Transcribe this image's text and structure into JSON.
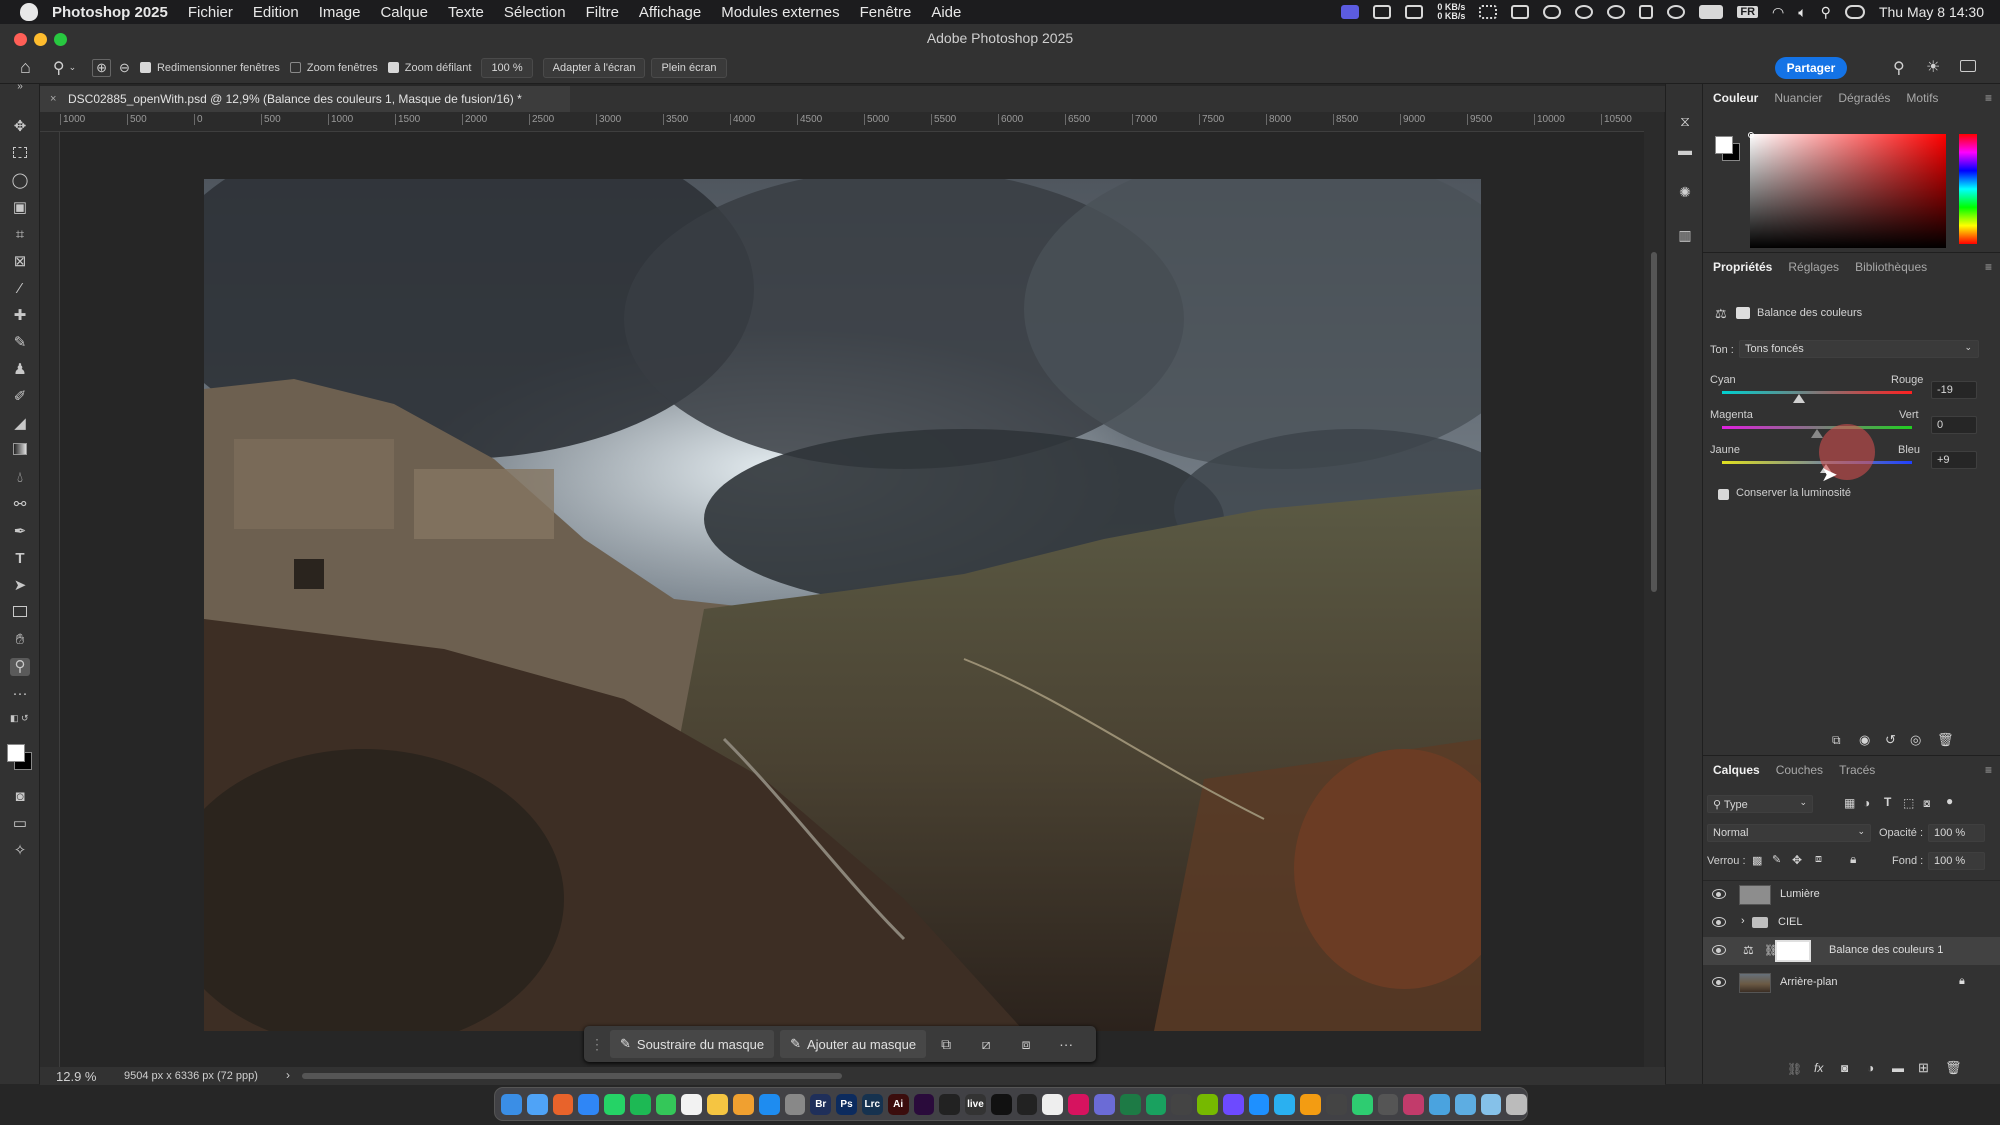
{
  "menubar": {
    "app_name": "Photoshop 2025",
    "items": [
      "Fichier",
      "Edition",
      "Image",
      "Calque",
      "Texte",
      "Sélection",
      "Filtre",
      "Affichage",
      "Modules externes",
      "Fenêtre",
      "Aide"
    ],
    "net_up": "0 KB/s",
    "net_down": "0 KB/s",
    "input_lang": "FR",
    "clock": "Thu May 8  14:30"
  },
  "window": {
    "title": "Adobe Photoshop 2025"
  },
  "options": {
    "resize_windows": "Redimensionner fenêtres",
    "zoom_windows": "Zoom fenêtres",
    "scrubby_zoom": "Zoom défilant",
    "zoom_pct": "100 %",
    "fit_screen": "Adapter à l'écran",
    "fill_screen": "Plein écran",
    "share": "Partager"
  },
  "document": {
    "tab_title": "DSC02885_openWith.psd @ 12,9% (Balance des couleurs 1, Masque de fusion/16) *",
    "zoom": "12.9 %",
    "dimensions": "9504 px x 6336 px (72 ppp)"
  },
  "ruler_ticks": [
    "1000",
    "500",
    "0",
    "500",
    "1000",
    "1500",
    "2000",
    "2500",
    "3000",
    "3500",
    "4000",
    "4500",
    "5000",
    "5500",
    "6000",
    "6500",
    "7000",
    "7500",
    "8000",
    "8500",
    "9000",
    "9500",
    "10000",
    "10500"
  ],
  "context_bar": {
    "subtract": "Soustraire du masque",
    "add": "Ajouter au masque",
    "more": "···"
  },
  "color_panel": {
    "tabs": [
      "Couleur",
      "Nuancier",
      "Dégradés",
      "Motifs"
    ]
  },
  "properties": {
    "tabs": [
      "Propriétés",
      "Réglages",
      "Bibliothèques"
    ],
    "adjustment_name": "Balance des couleurs",
    "tone_label": "Ton :",
    "tone_value": "Tons foncés",
    "sliders": [
      {
        "left": "Cyan",
        "right": "Rouge",
        "value": "-19",
        "level": -19
      },
      {
        "left": "Magenta",
        "right": "Vert",
        "value": "0",
        "level": 0
      },
      {
        "left": "Jaune",
        "right": "Bleu",
        "value": "+9",
        "level": 9
      }
    ],
    "preserve_luminosity": "Conserver la luminosité"
  },
  "layers_panel": {
    "tabs": [
      "Calques",
      "Couches",
      "Tracés"
    ],
    "filter": "Type",
    "blend_mode": "Normal",
    "opacity_label": "Opacité :",
    "opacity": "100 %",
    "lock_label": "Verrou :",
    "fill_label": "Fond :",
    "fill": "100 %",
    "layers": [
      {
        "name": "Lumière"
      },
      {
        "name": "CIEL"
      },
      {
        "name": "Balance des couleurs 1"
      },
      {
        "name": "Arrière-plan"
      }
    ]
  },
  "dock": {
    "apps": [
      "finder-icon",
      "safari-icon",
      "firefox-icon",
      "mail-icon",
      "whatsapp-icon",
      "spotify-icon",
      "messages-icon",
      "calendar-icon",
      "notes-icon",
      "files-icon",
      "appstore-icon",
      "settings-icon",
      "bridge-icon",
      "photoshop-icon",
      "lightroom-classic-icon",
      "illustrator-icon",
      "premiere-icon",
      "terminal-icon",
      "live-icon",
      "capcut-icon",
      "davinci-icon",
      "final-cut-icon",
      "instruments-icon",
      "preview-icon",
      "excel-icon",
      "numbers-icon",
      "chatgpt-icon",
      "nvidia-icon",
      "proton-icon",
      "cloud-icon",
      "ai-icon",
      "sublime-icon",
      "screen-icon",
      "facetime-icon",
      "keyboard-icon",
      "affinity-icon",
      "finder-folder-icon",
      "downloads-icon",
      "folder-icon",
      "trash-icon"
    ],
    "labels": {
      "bridge-icon": "Br",
      "photoshop-icon": "Ps",
      "lightroom-classic-icon": "Lrc",
      "illustrator-icon": "Ai",
      "live-icon": "live"
    }
  }
}
